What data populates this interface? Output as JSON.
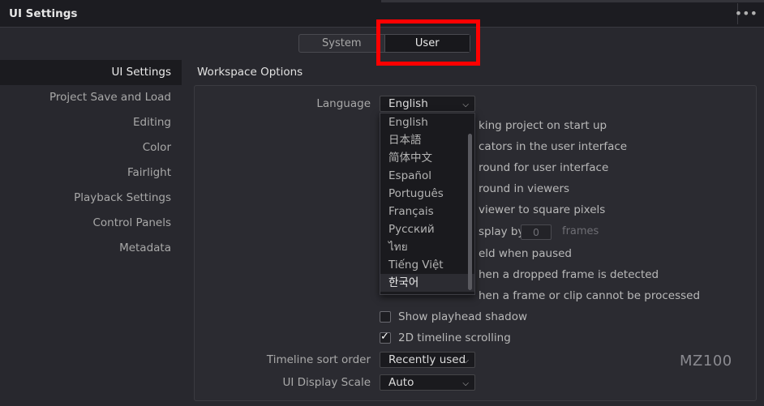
{
  "window": {
    "title": "UI Settings",
    "more": "•••"
  },
  "tabs": [
    {
      "label": "System"
    },
    {
      "label": "User"
    }
  ],
  "sidebar": {
    "items": [
      {
        "label": "UI Settings"
      },
      {
        "label": "Project Save and Load"
      },
      {
        "label": "Editing"
      },
      {
        "label": "Color"
      },
      {
        "label": "Fairlight"
      },
      {
        "label": "Playback Settings"
      },
      {
        "label": "Control Panels"
      },
      {
        "label": "Metadata"
      }
    ]
  },
  "workspace": {
    "title": "Workspace Options",
    "language": {
      "label": "Language",
      "value": "English"
    },
    "options": [
      {
        "text": "king project on start up"
      },
      {
        "text": "cators in the user interface"
      },
      {
        "text": "round for user interface"
      },
      {
        "text": "round in viewers"
      },
      {
        "text": "viewer to square pixels"
      },
      {
        "text": "splay by"
      },
      {
        "text": "eld when paused"
      },
      {
        "text": "hen a dropped frame is detected"
      },
      {
        "text": "hen a frame or clip cannot be processed"
      }
    ],
    "display_frames": {
      "value": "0",
      "unit": "frames"
    },
    "show_playhead_shadow": {
      "label": "Show playhead shadow",
      "checked": false
    },
    "timeline_2d_scrolling": {
      "label": "2D timeline scrolling",
      "checked": true
    },
    "timeline_sort_order": {
      "label": "Timeline sort order",
      "value": "Recently used"
    },
    "ui_display_scale": {
      "label": "UI Display Scale",
      "value": "Auto"
    }
  },
  "language_dropdown": {
    "options": [
      "English",
      "日本語",
      "简体中文",
      "Español",
      "Português",
      "Français",
      "Русский",
      "ไทย",
      "Tiếng Việt",
      "한국어"
    ],
    "hovered": "한국어"
  },
  "watermark": "MZ100"
}
